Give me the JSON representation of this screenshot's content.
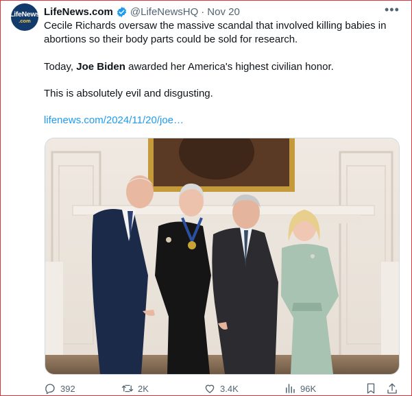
{
  "tweet": {
    "display_name": "LifeNews.com",
    "handle": "@LifeNewsHQ",
    "separator": "·",
    "date": "Nov 20",
    "avatar_line1": "LifeNews",
    "avatar_line2": ".com",
    "text_p1": "Cecile Richards oversaw the massive scandal that involved killing babies in abortions so their body parts could be sold for research.",
    "text_p2_before": "Today, ",
    "text_p2_bold": "Joe Biden",
    "text_p2_after": " awarded her America's highest civilian honor.",
    "text_p3": "This is absolutely evil and disgusting.",
    "link": "lifenews.com/2024/11/20/joe…",
    "more_label": "•••"
  },
  "actions": {
    "replies": "392",
    "reposts": "2K",
    "likes": "3.4K",
    "views": "96K"
  },
  "icons": {
    "verified": "verified-badge-icon",
    "more": "more-options-icon",
    "reply": "reply-icon",
    "repost": "repost-icon",
    "like": "heart-icon",
    "views": "views-icon",
    "bookmark": "bookmark-icon",
    "share": "share-icon"
  },
  "colors": {
    "link": "#1d9bf0",
    "verified": "#1d9bf0",
    "muted": "#536471",
    "text": "#0f1419",
    "frame": "#d9363e"
  }
}
